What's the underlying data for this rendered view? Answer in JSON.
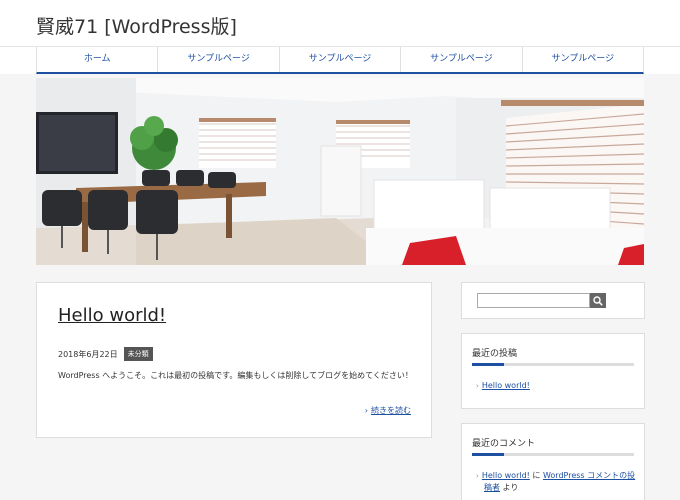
{
  "site": {
    "title": "賢威71 [WordPress版]"
  },
  "nav": {
    "items": [
      {
        "label": "ホーム"
      },
      {
        "label": "サンプルページ"
      },
      {
        "label": "サンプルページ"
      },
      {
        "label": "サンプルページ"
      },
      {
        "label": "サンプルページ"
      }
    ]
  },
  "post": {
    "title": "Hello world!",
    "date": "2018年6月22日",
    "category": "未分類",
    "excerpt": "WordPress へようこそ。これは最初の投稿です。編集もしくは削除してブログを始めてください！",
    "more": "続きを読む"
  },
  "sidebar": {
    "search": {
      "placeholder": ""
    },
    "recent_posts": {
      "title": "最近の投稿",
      "items": [
        {
          "label": "Hello world!"
        }
      ]
    },
    "recent_comments": {
      "title": "最近のコメント",
      "items": [
        {
          "post": "Hello world!",
          "connector": " に ",
          "author": "WordPress コメントの投稿者",
          "suffix": " より"
        }
      ]
    }
  },
  "colors": {
    "accent": "#1e50a2",
    "chair_red": "#d8202a"
  }
}
